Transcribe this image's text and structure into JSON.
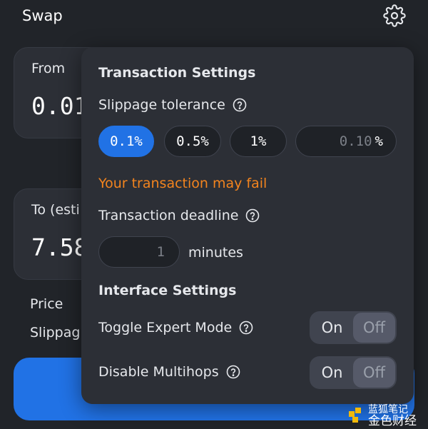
{
  "swap": {
    "title": "Swap",
    "from_label": "From",
    "from_amount": "0.01",
    "to_label": "To (esti",
    "to_amount": "7.58",
    "price_label": "Price",
    "slippage_label": "Slippag"
  },
  "settings": {
    "transaction_heading": "Transaction Settings",
    "slippage_label": "Slippage tolerance",
    "slippage_options": [
      "0.1%",
      "0.5%",
      "1%"
    ],
    "selected_slippage": "0.1%",
    "custom_value": "0.10",
    "custom_unit": "%",
    "warning": "Your transaction may fail",
    "deadline_label": "Transaction deadline",
    "deadline_value": "1",
    "deadline_unit": "minutes",
    "interface_heading": "Interface Settings",
    "expert_mode_label": "Toggle Expert Mode",
    "multihops_label": "Disable Multihops",
    "toggle_on": "On",
    "toggle_off": "Off"
  },
  "watermark": {
    "line1": "蓝狐笔记",
    "line2": "金色财经"
  },
  "colors": {
    "background": "#212429",
    "popover": "#2c2f36",
    "accent": "#2172e5",
    "warning": "#f3841e"
  },
  "icons": {
    "settings": "gear-icon",
    "help": "question-circle-icon"
  }
}
